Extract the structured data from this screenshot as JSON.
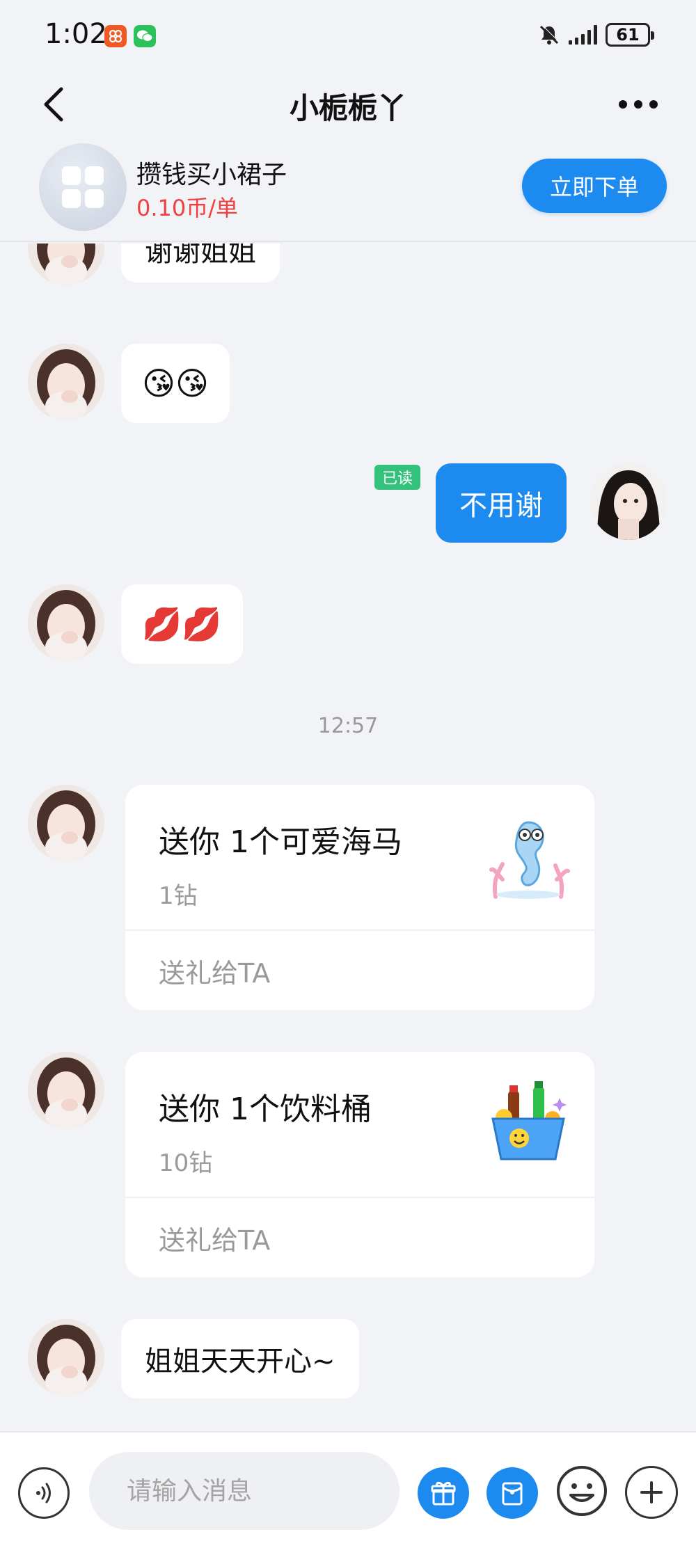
{
  "status_bar": {
    "time": "1:02",
    "battery": "61",
    "app_badges": [
      "taobao-icon",
      "wechat-icon"
    ],
    "silent_icon": "bell-off-icon",
    "signal_icon": "cell-signal-icon"
  },
  "header": {
    "title": "小栀栀丫",
    "back_icon": "chevron-left-icon",
    "more_icon": "more-dots-icon"
  },
  "order_banner": {
    "service_name": "攒钱买小裙子",
    "price": "0.10币/单",
    "order_button": "立即下单",
    "price_color": "#f04040"
  },
  "messages": [
    {
      "from": "other",
      "type": "text",
      "text": "谢谢姐姐"
    },
    {
      "from": "other",
      "type": "emoji",
      "text": "😘😘"
    },
    {
      "from": "me",
      "type": "text",
      "text": "不用谢",
      "read_label": "已读"
    },
    {
      "from": "other",
      "type": "emoji",
      "text": "💋💋"
    },
    {
      "type": "timestamp",
      "text": "12:57"
    },
    {
      "from": "other",
      "type": "gift",
      "title": "送你 1个可爱海马",
      "price": "1钻",
      "action": "送礼给TA",
      "image": "seahorse-gift-icon"
    },
    {
      "from": "other",
      "type": "gift",
      "title": "送你 1个饮料桶",
      "price": "10钻",
      "action": "送礼给TA",
      "image": "drink-bucket-gift-icon"
    },
    {
      "from": "other",
      "type": "text",
      "text": "姐姐天天开心~"
    }
  ],
  "input_bar": {
    "placeholder": "请输入消息",
    "icons": [
      "voice-icon",
      "gift-icon",
      "red-packet-icon",
      "emoji-icon",
      "plus-icon"
    ]
  },
  "colors": {
    "accent": "#1d8af0",
    "read_badge": "#32c27c",
    "background": "#f2f3f7"
  }
}
